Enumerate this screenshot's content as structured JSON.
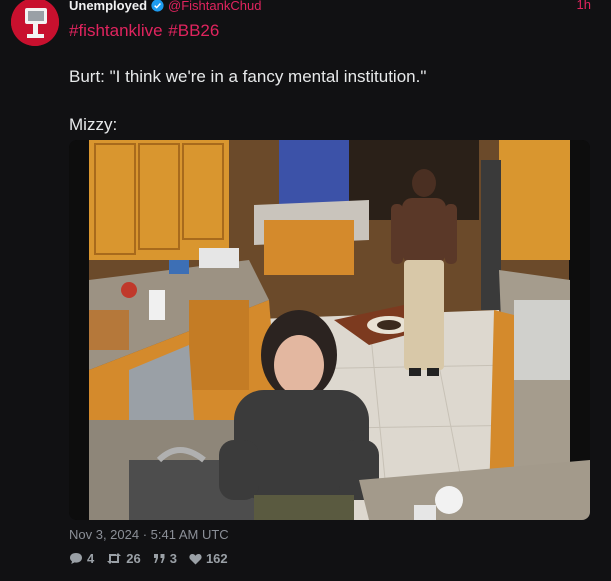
{
  "post": {
    "author": {
      "display_name": "Unemployed",
      "handle": "@FishtankChud",
      "verified": true,
      "avatar_icon": "camera-logo-icon"
    },
    "time_ago": "1h",
    "hashtags": "#fishtanklive #BB26",
    "quote": "Burt: \"I think we're in a fancy mental institution.\"",
    "speaker": "Mizzy:",
    "media": {
      "kind": "photo",
      "description_icon": "kitchen-camera-photo"
    },
    "timestamp": "Nov 3, 2024 · 5:41 AM UTC",
    "stats": {
      "replies": "4",
      "reposts": "26",
      "quotes": "3",
      "likes": "162"
    }
  },
  "colors": {
    "background": "#111113",
    "accent": "#e0245e",
    "verified": "#1d9bf0",
    "muted": "#8b8f97"
  }
}
